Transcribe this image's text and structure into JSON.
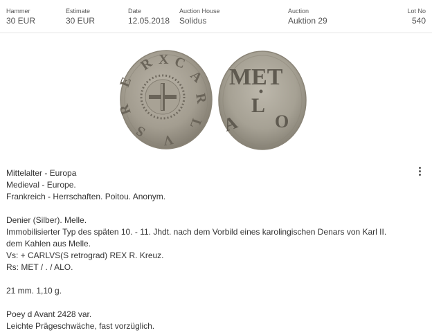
{
  "header": {
    "hammer": {
      "label": "Hammer",
      "value": "30 EUR"
    },
    "estimate": {
      "label": "Estimate",
      "value": "30 EUR"
    },
    "date": {
      "label": "Date",
      "value": "12.05.2018"
    },
    "auction_house": {
      "label": "Auction House",
      "value": "Solidus"
    },
    "auction": {
      "label": "Auction",
      "value": "Auktion 29"
    },
    "lot_no": {
      "label": "Lot No",
      "value": "540"
    }
  },
  "coin": {
    "obverse_icon": "coin-obverse-cross",
    "reverse_legend": [
      "MET",
      "ALO"
    ],
    "color": "#a09a8d"
  },
  "description": {
    "block1": [
      "Mittelalter - Europa",
      "Medieval - Europe.",
      "Frankreich - Herrschaften. Poitou. Anonym."
    ],
    "block2": [
      "Denier (Silber). Melle.",
      "Immobilisierter Typ des späten 10. - 11. Jhdt. nach dem Vorbild eines karolingischen Denars von Karl II.",
      "dem Kahlen aus Melle.",
      "Vs: + CARLVS(S retrograd) REX R. Kreuz.",
      "Rs: MET / . / ALO."
    ],
    "block3": [
      "21 mm. 1,10 g."
    ],
    "block4": [
      "Poey d Avant 2428 var.",
      "Leichte Prägeschwäche, fast vorzüglich."
    ]
  },
  "menu": {
    "icon": "more-vertical-icon"
  }
}
